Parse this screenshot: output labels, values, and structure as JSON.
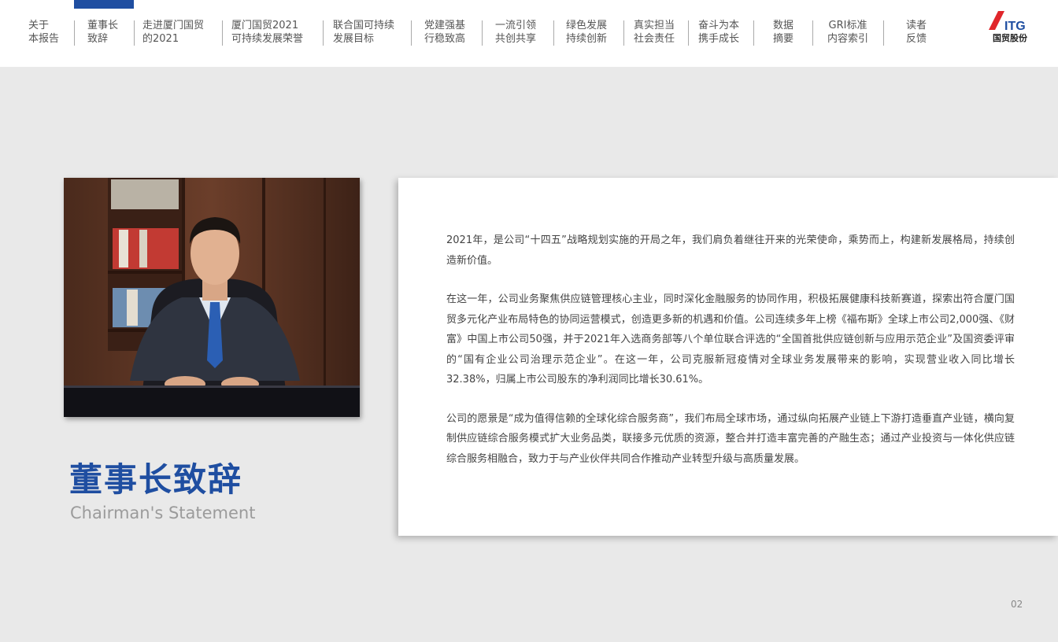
{
  "nav": {
    "items": [
      {
        "line1": "关于",
        "line2": "本报告"
      },
      {
        "line1": "董事长",
        "line2": "致辞"
      },
      {
        "line1": "走进厦门国贸",
        "line2": "的2021"
      },
      {
        "line1": "厦门国贸2021",
        "line2": "可持续发展荣誉"
      },
      {
        "line1": "联合国可持续",
        "line2": "发展目标"
      },
      {
        "line1": "党建强基",
        "line2": "行稳致高"
      },
      {
        "line1": "一流引领",
        "line2": "共创共享"
      },
      {
        "line1": "绿色发展",
        "line2": "持续创新"
      },
      {
        "line1": "真实担当",
        "line2": "社会责任"
      },
      {
        "line1": "奋斗为本",
        "line2": "携手成长"
      },
      {
        "line1": "数据",
        "line2": "摘要"
      },
      {
        "line1": "GRI标准",
        "line2": "内容索引"
      },
      {
        "line1": "读者",
        "line2": "反馈"
      }
    ],
    "active_color": "#1f4ea1"
  },
  "logo": {
    "mark": "ITG",
    "name": "国贸股份",
    "brand_red": "#e0262b",
    "brand_blue": "#1f4ea1"
  },
  "title": {
    "zh": "董事长致辞",
    "en": "Chairman's Statement"
  },
  "body": {
    "paragraphs": [
      "2021年，是公司“十四五”战略规划实施的开局之年，我们肩负着继往开来的光荣使命，乘势而上，构建新发展格局，持续创造新价值。",
      "在这一年，公司业务聚焦供应链管理核心主业，同时深化金融服务的协同作用，积极拓展健康科技新赛道，探索出符合厦门国贸多元化产业布局特色的协同运营模式，创造更多新的机遇和价值。公司连续多年上榜《福布斯》全球上市公司2,000强、《财富》中国上市公司50强，并于2021年入选商务部等八个单位联合评选的“全国首批供应链创新与应用示范企业”及国资委评审的“国有企业公司治理示范企业”。在这一年，公司克服新冠疫情对全球业务发展带来的影响，实现营业收入同比增长32.38%，归属上市公司股东的净利润同比增长30.61%。",
      "公司的愿景是“成为值得信赖的全球化综合服务商”，我们布局全球市场，通过纵向拓展产业链上下游打造垂直产业链，横向复制供应链综合服务模式扩大业务品类，联接多元优质的资源，整合并打造丰富完善的产融生态；通过产业投资与一体化供应链综合服务相融合，致力于与产业伙伴共同合作推动产业转型升级与高质量发展。"
    ]
  },
  "page": {
    "number": "02"
  }
}
